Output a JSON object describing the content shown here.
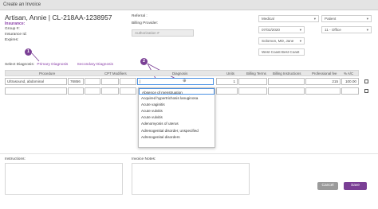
{
  "window": {
    "title": "Create an Invoice"
  },
  "patient": {
    "name_line": "Artisan, Annie | CL-218AA-1238957",
    "insurance_label": "Insurance:",
    "group_label": "Group #:",
    "insurance_id_label": "Insurance Id:",
    "expires_label": "Expires:"
  },
  "referral": {
    "label": "Referral :",
    "billing_provider_label": "Billing Provider:",
    "authorization_placeholder": "Authorization #",
    "date": "07/02/2020",
    "provider": "Solomon, MD, Jane",
    "facility": "West Coast Best Coast"
  },
  "right": {
    "insurance_type": "Medical",
    "payer": "Patient",
    "place_of_service": "11 - Office"
  },
  "diagnosis": {
    "select_label": "Select Diagnosis:",
    "primary": "Primary Diagnosis",
    "secondary": "Secondary Diagnosis"
  },
  "table": {
    "headers": [
      "Procedure",
      "CPT Modifiers",
      "Diagnosis",
      "Units",
      "Billing Terms",
      "Billing Instructions",
      "Professional fee",
      "% A/C"
    ],
    "row1": {
      "procedure": "Ultrasound, abdominal",
      "cpt": "76856",
      "units": "1",
      "fee": "215",
      "ac": "100.00"
    }
  },
  "dropdown": {
    "options": [
      "Absence of menstruation",
      "Acquired hypertrichosis lanuginosa",
      "Acute vaginitis",
      "Acute vulvitis",
      "Acute vulvitis",
      "Adenomyosis of uterus",
      "Adrenogenital disorder, unspecified",
      "Adrenogenital disorders"
    ]
  },
  "notes": {
    "instructions_label": "Instructions:",
    "invoice_notes_label": "Invoice Notes:"
  },
  "buttons": {
    "cancel": "Cancel",
    "save": "Save"
  },
  "badges": {
    "one": "1",
    "two": "2"
  },
  "colors": {
    "accent": "#7a3f95",
    "focus": "#4a90e2"
  }
}
